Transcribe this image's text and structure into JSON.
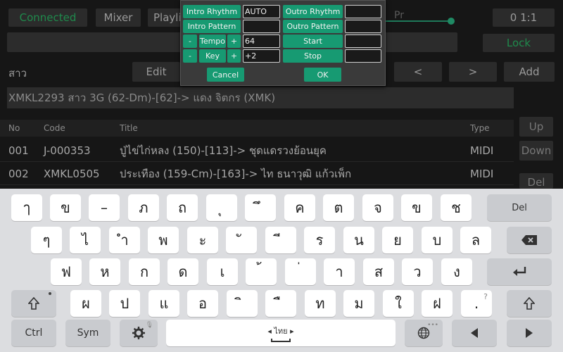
{
  "top_bar": {
    "connected": "Connected",
    "mixer": "Mixer",
    "playlist": "Playlist",
    "pr": "Pr",
    "counter": "0  1:1",
    "lock": "Lock"
  },
  "search": {
    "query": "สาว",
    "edit": "Edit",
    "prev": "<",
    "next": ">",
    "add": "Add"
  },
  "song_title": "XMKL2293 สาว 3G (62-Dm)-[62]-> แดง จิตกร (XMK)",
  "table": {
    "headers": {
      "no": "No",
      "code": "Code",
      "title": "Title",
      "type": "Type"
    },
    "rows": [
      {
        "no": "001",
        "code": "J-000353",
        "title": "ปู่ไข่ไก่หลง (150)-[113]-> ชุดแดรวงย้อนยุค",
        "type": "MIDI"
      },
      {
        "no": "002",
        "code": "XMKL0505",
        "title": "ประเทือง (159-Cm)-[163]-> ไท ธนาวุฒิ แก้วเพ็ก",
        "type": "MIDI"
      }
    ]
  },
  "side_buttons": {
    "up": "Up",
    "down": "Down",
    "del": "Del"
  },
  "modal": {
    "intro_rhythm": "Intro Rhythm",
    "intro_rhythm_value": "AUTO",
    "outro_rhythm": "Outro Rhythm",
    "outro_rhythm_value": "",
    "intro_pattern": "Intro Pattern",
    "intro_pattern_value": "",
    "outro_pattern": "Outro Pattern",
    "outro_pattern_value": "",
    "minus": "-",
    "plus": "+",
    "tempo": "Tempo",
    "tempo_value": "64",
    "start": "Start",
    "start_value": "",
    "key": "Key",
    "key_value": "+2",
    "stop": "Stop",
    "stop_value": "",
    "cancel": "Cancel",
    "ok": "OK"
  },
  "keyboard": {
    "row1": [
      "ๅ",
      "ข",
      "–",
      "ภ",
      "ถ",
      "ุ",
      "ึ",
      "ค",
      "ต",
      "จ",
      "ข",
      "ช"
    ],
    "del": "Del",
    "row2": [
      "ๆ",
      "ไ",
      "ำ",
      "พ",
      "ะ",
      "ั",
      "ี",
      "ร",
      "น",
      "ย",
      "บ",
      "ล"
    ],
    "row3": [
      "ฟ",
      "ห",
      "ก",
      "ด",
      "เ",
      "้",
      "่",
      "า",
      "ส",
      "ว",
      "ง"
    ],
    "row4": [
      "ผ",
      "ป",
      "แ",
      "อ",
      "ิ",
      "ื",
      "ท",
      "ม",
      "ใ",
      "ฝ"
    ],
    "row4_punct_hint": "?",
    "row4_punct": ".",
    "ctrl": "Ctrl",
    "sym": "Sym",
    "language": "ไทย"
  }
}
